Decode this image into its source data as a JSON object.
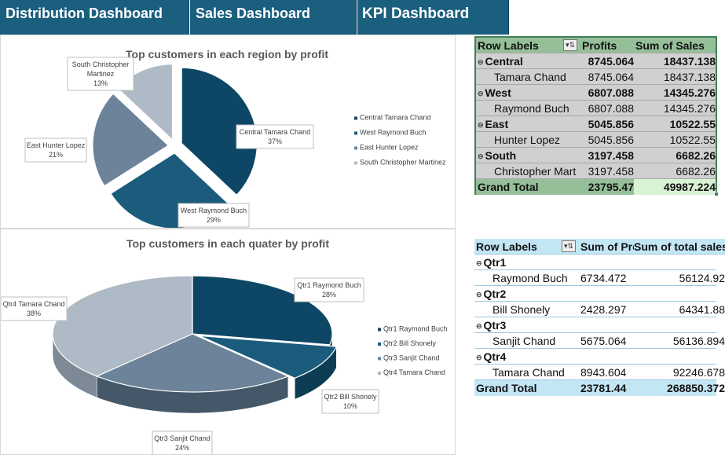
{
  "tabs": [
    {
      "label": "Distribution Dashboard"
    },
    {
      "label": "Sales Dashboard"
    },
    {
      "label": "KPI Dashboard"
    }
  ],
  "colors": {
    "tab_bg": "#1b5f7f",
    "pie_dark_blue": "#0e4766",
    "pie_mid_blue": "#1b5c7c",
    "pie_slate": "#6c8399",
    "pie_light_gray": "#aebac5"
  },
  "chart_data": [
    {
      "type": "pie",
      "title": "Top customers in each region by profit",
      "categories": [
        "Central Tamara Chand",
        "West Raymond Buch",
        "East Hunter Lopez",
        "South Christopher Martinez"
      ],
      "values": [
        37,
        29,
        21,
        13
      ],
      "value_labels": [
        "37%",
        "29%",
        "21%",
        "13%"
      ],
      "legend": [
        "Central Tamara Chand",
        "West Raymond Buch",
        "East Hunter Lopez",
        "South Christopher Martinez"
      ],
      "legend_position": "right",
      "exploded": true
    },
    {
      "type": "pie",
      "title": "Top customers in each quater by profit",
      "categories": [
        "Qtr1 Raymond Buch",
        "Qtr2 Bill Shonely",
        "Qtr3 Sanjit Chand",
        "Qtr4 Tamara Chand"
      ],
      "values": [
        28,
        10,
        24,
        38
      ],
      "value_labels": [
        "28%",
        "10%",
        "24%",
        "38%"
      ],
      "legend": [
        "Qtr1 Raymond Buch",
        "Qtr2 Bill Shonely",
        "Qtr3 Sanjit Chand",
        "Qtr4 Tamara Chand"
      ],
      "legend_position": "right",
      "three_d": true
    }
  ],
  "pivot_region": {
    "headers": [
      "Row Labels",
      "Profits",
      "Sum of Sales"
    ],
    "rows": [
      {
        "label": "Central",
        "profit": "8745.064",
        "sales": "18437.138",
        "group": true
      },
      {
        "label": "Tamara Chand",
        "profit": "8745.064",
        "sales": "18437.138",
        "group": false
      },
      {
        "label": "West",
        "profit": "6807.088",
        "sales": "14345.276",
        "group": true
      },
      {
        "label": "Raymond Buch",
        "profit": "6807.088",
        "sales": "14345.276",
        "group": false
      },
      {
        "label": "East",
        "profit": "5045.856",
        "sales": "10522.55",
        "group": true
      },
      {
        "label": "Hunter Lopez",
        "profit": "5045.856",
        "sales": "10522.55",
        "group": false
      },
      {
        "label": "South",
        "profit": "3197.458",
        "sales": "6682.26",
        "group": true
      },
      {
        "label": "Christopher Mart",
        "profit": "3197.458",
        "sales": "6682.26",
        "group": false
      }
    ],
    "total": {
      "label": "Grand Total",
      "profit": "23795.47",
      "sales": "49987.224"
    }
  },
  "pivot_quarter": {
    "headers": [
      "Row Labels",
      "Sum of Pro",
      "Sum of total sales"
    ],
    "rows": [
      {
        "label": "Qtr1",
        "profit": "",
        "sales": "",
        "group": true
      },
      {
        "label": "Raymond Buch",
        "profit": "6734.472",
        "sales": "56124.92",
        "group": false
      },
      {
        "label": "Qtr2",
        "profit": "",
        "sales": "",
        "group": true
      },
      {
        "label": "Bill Shonely",
        "profit": "2428.297",
        "sales": "64341.88",
        "group": false
      },
      {
        "label": "Qtr3",
        "profit": "",
        "sales": "",
        "group": true
      },
      {
        "label": "Sanjit Chand",
        "profit": "5675.064",
        "sales": "56136.894",
        "group": false
      },
      {
        "label": "Qtr4",
        "profit": "",
        "sales": "",
        "group": true
      },
      {
        "label": "Tamara Chand",
        "profit": "8943.604",
        "sales": "92246.678",
        "group": false
      }
    ],
    "total": {
      "label": "Grand Total",
      "profit": "23781.44",
      "sales": "268850.372"
    }
  }
}
